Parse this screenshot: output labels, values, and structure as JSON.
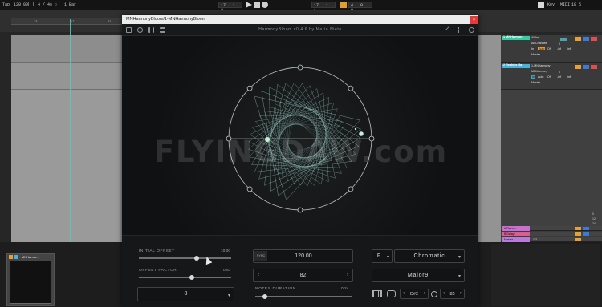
{
  "transport": {
    "left_items": [
      "Tap",
      "120.00",
      "|||",
      "4 / 4",
      "⊙ ○",
      "1 Bar"
    ],
    "position": "17 . 1 . 3",
    "loop_pos": "17 . 1 . 1",
    "loop_len": "4 . 0 . 0",
    "right_items": [
      "Key",
      "MIDI",
      "18 %"
    ]
  },
  "ruler": {
    "marks": [
      "13",
      "17",
      "21"
    ],
    "bottom_marks": [
      "0:30",
      "0:40"
    ]
  },
  "mixer": {
    "tracks": [
      {
        "name": "1 MNHarmon",
        "color": "#38c9a5",
        "input": "All Ins",
        "channel": "All Channels",
        "monitor": [
          "In",
          "Auto",
          "Off"
        ],
        "route": "Master",
        "vals": [
          "0",
          "-inf",
          "-inf"
        ]
      },
      {
        "name": "2 Reaktor Ra",
        "color": "#4bb1d9",
        "input": "1-MNHarmony",
        "channel": "MNHarmony",
        "monitor": [
          "In",
          "Auto",
          "Off"
        ],
        "route": "Master",
        "vals": [
          "0",
          "-inf",
          "-inf"
        ]
      }
    ],
    "returns": [
      {
        "name": "A Reverb",
        "color": "#c86fd1"
      },
      {
        "name": "B Delay",
        "color": "#d9608e"
      },
      {
        "name": "Master",
        "color": "#b77bd8",
        "extra": "1/2"
      }
    ],
    "scale_nums": [
      "0",
      "12",
      "24",
      "36",
      "48",
      "60"
    ]
  },
  "clip": {
    "title": "MNHarmo..."
  },
  "plugin": {
    "window_title": "MNHarmonyBloom/1-MNHarmonyBloom",
    "close": "×",
    "header_title": "HarmonyBloom v0.4.6 by Mario Nieto",
    "initial_offset": {
      "label": "INITIAL OFFSET",
      "value": "10.00",
      "level": 0.63
    },
    "offset_factor": {
      "label": "OFFSET FACTOR",
      "value": "0.57",
      "level": 0.57
    },
    "notes_duration": {
      "label": "NOTES DURATION",
      "value": "0.24",
      "level": 0.1
    },
    "sync_label": "SYNC",
    "bpm": "120.00",
    "note_count": "82",
    "octave_select": "8",
    "root_note": "F",
    "scale": "Chromatic",
    "chord": "Major9",
    "range_low": "D#2",
    "range_high": "85"
  },
  "watermark": "FLYINGDAW.com"
}
